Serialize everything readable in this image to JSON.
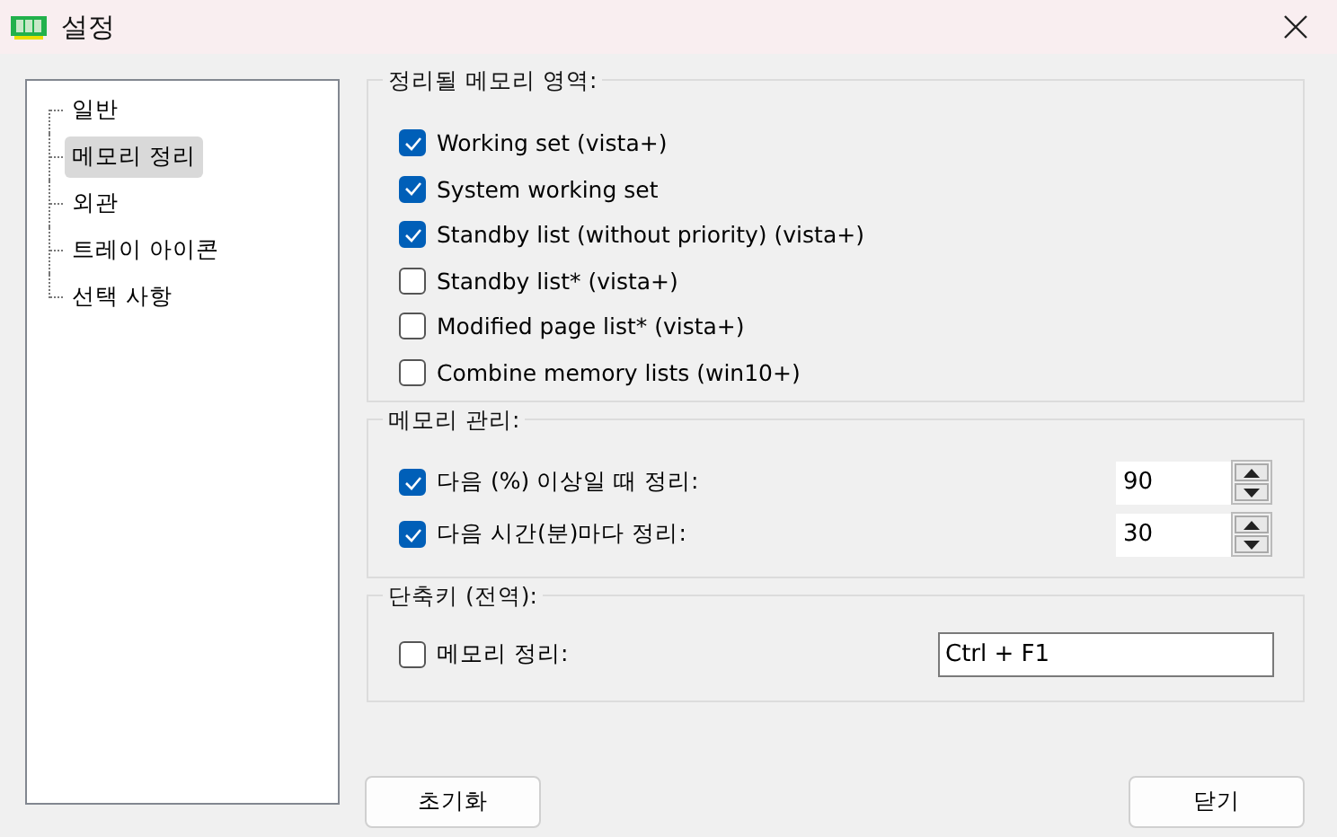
{
  "window": {
    "title": "설정"
  },
  "sidebar": {
    "items": [
      {
        "label": "일반",
        "selected": false
      },
      {
        "label": "메모리 정리",
        "selected": true
      },
      {
        "label": "외관",
        "selected": false
      },
      {
        "label": "트레이 아이콘",
        "selected": false
      },
      {
        "label": "선택 사항",
        "selected": false
      }
    ]
  },
  "groups": [
    {
      "title": "정리될 메모리 영역:",
      "rows": [
        {
          "kind": "check",
          "label": "Working set (vista+)",
          "checked": true
        },
        {
          "kind": "check",
          "label": "System working set",
          "checked": true
        },
        {
          "kind": "check",
          "label": "Standby list (without priority) (vista+)",
          "checked": true
        },
        {
          "kind": "check",
          "label": "Standby list* (vista+)",
          "checked": false
        },
        {
          "kind": "check",
          "label": "Modified page list* (vista+)",
          "checked": false
        },
        {
          "kind": "check",
          "label": "Combine memory lists (win10+)",
          "checked": false
        }
      ]
    },
    {
      "title": "메모리 관리:",
      "rows": [
        {
          "kind": "spin",
          "label": "다음 (%) 이상일 때 정리:",
          "checked": true,
          "value": "90"
        },
        {
          "kind": "spin",
          "label": "다음 시간(분)마다 정리:",
          "checked": true,
          "value": "30"
        }
      ]
    },
    {
      "title": "단축키 (전역):",
      "rows": [
        {
          "kind": "hotkey",
          "label": "메모리 정리:",
          "checked": false,
          "value": "Ctrl + F1"
        }
      ]
    }
  ],
  "buttons": [
    {
      "label": "초기화"
    },
    {
      "label": "닫기"
    }
  ]
}
